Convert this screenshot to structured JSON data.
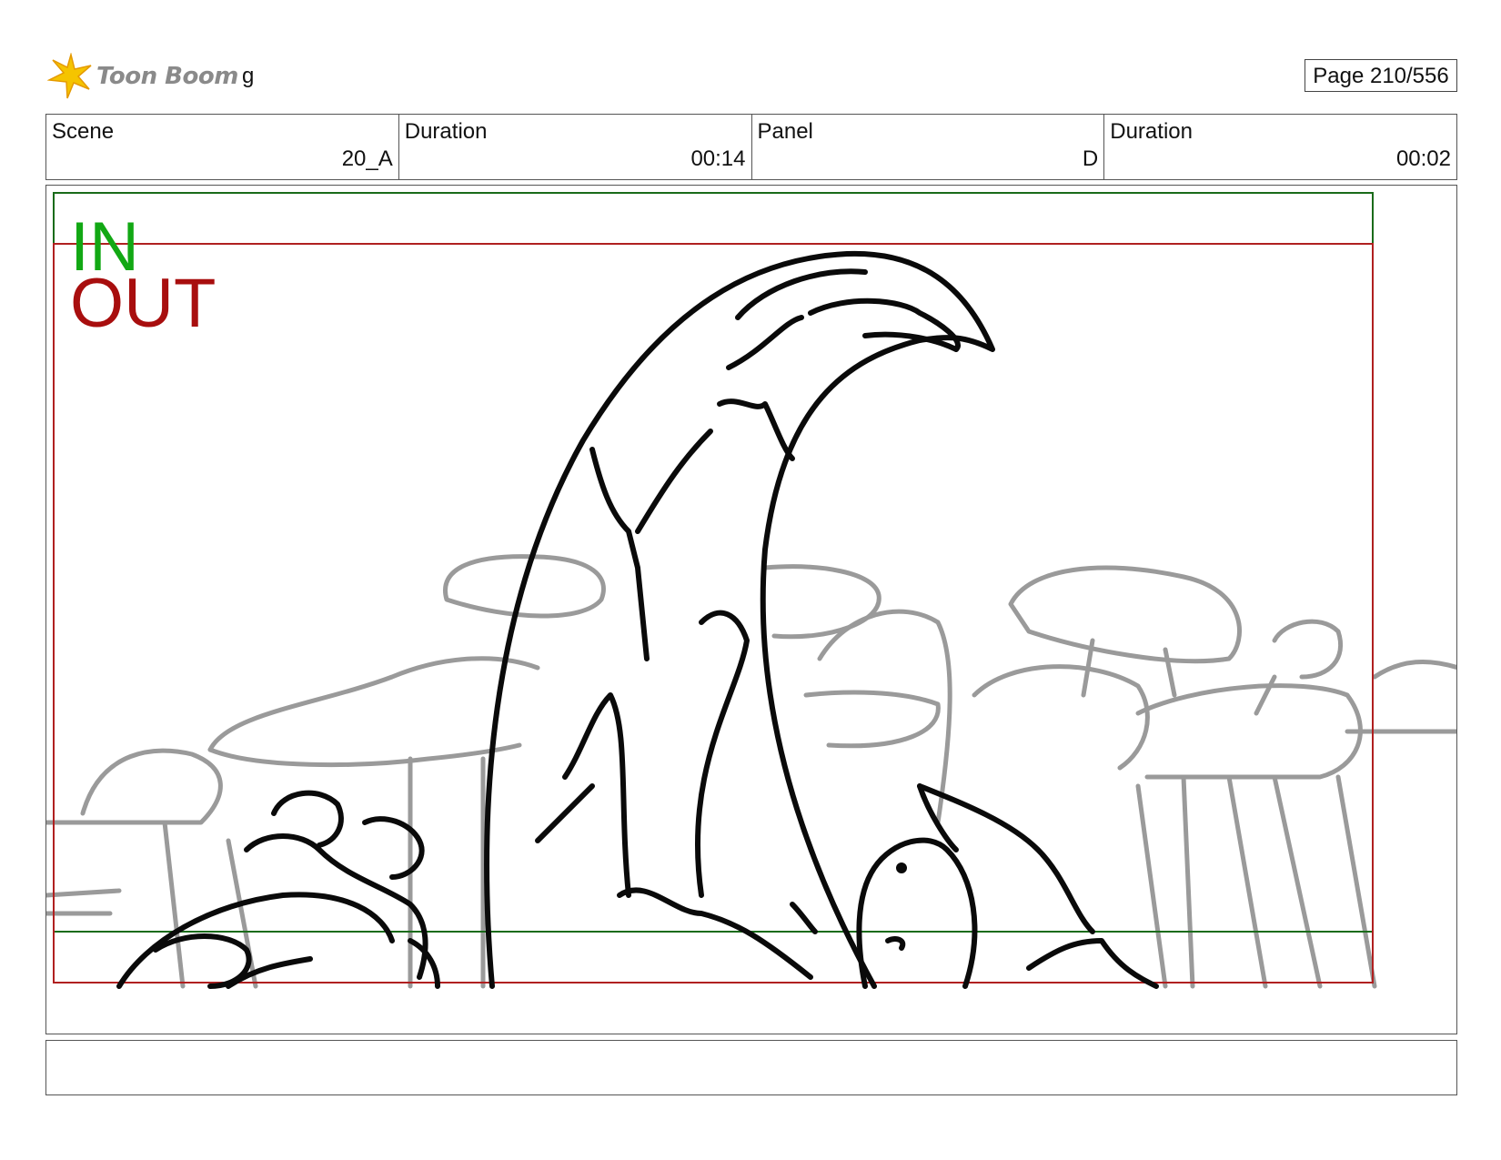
{
  "header": {
    "logo_text": "Toon Boom",
    "project_name": "g",
    "page_label": "Page 210/556"
  },
  "info": {
    "scene_label": "Scene",
    "scene_value": "20_A",
    "scene_duration_label": "Duration",
    "scene_duration_value": "00:14",
    "panel_label": "Panel",
    "panel_value": "D",
    "panel_duration_label": "Duration",
    "panel_duration_value": "00:02"
  },
  "frame": {
    "in_label": "IN",
    "out_label": "OUT",
    "in_color": "#12a814",
    "out_color": "#a80e0e"
  },
  "notes": {
    "text": ""
  }
}
